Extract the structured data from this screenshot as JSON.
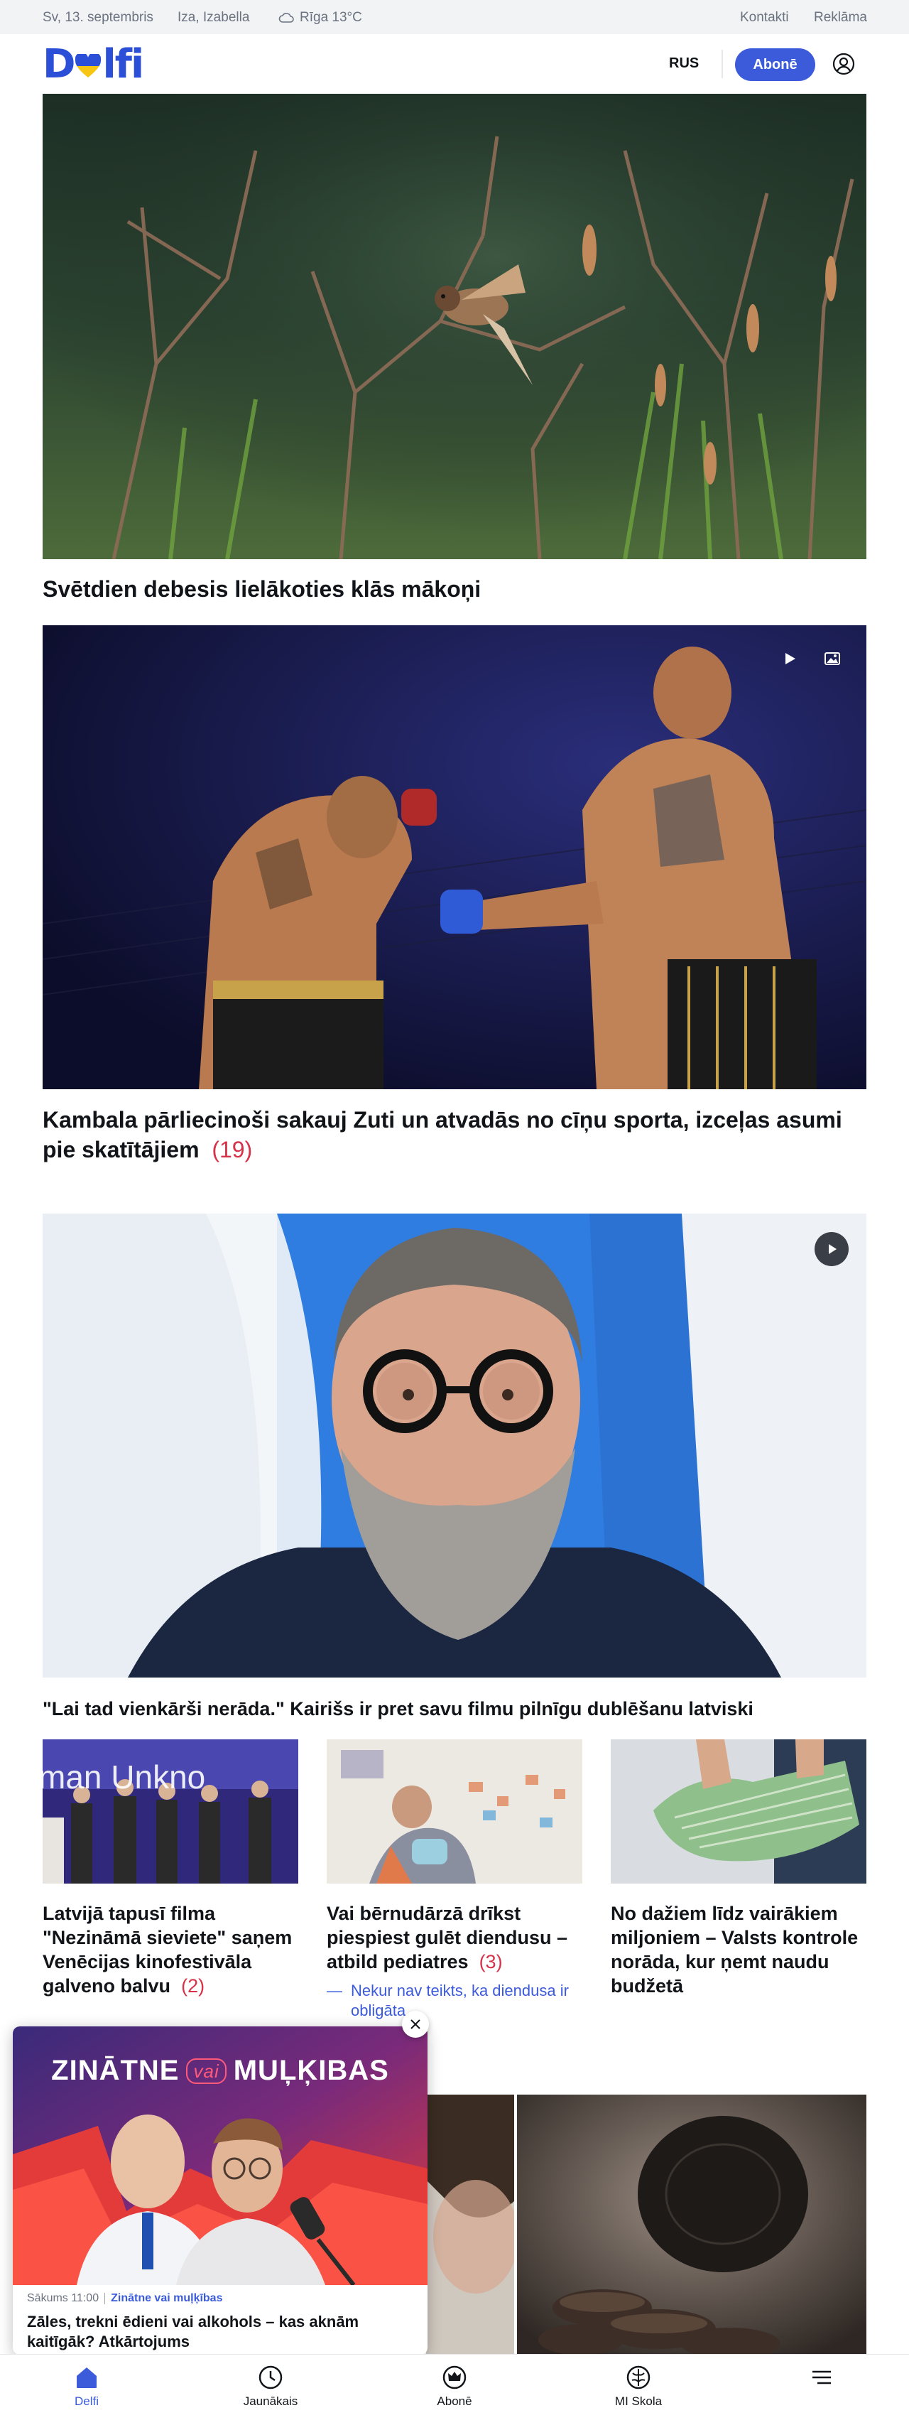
{
  "topbar": {
    "date": "Sv, 13. septembris",
    "namedays": "Iza, Izabella",
    "weather": "Rīga 13°C",
    "links": [
      "Kontakti",
      "Reklāma"
    ]
  },
  "header": {
    "logo": "Delfi",
    "language": "RUS",
    "subscribe": "Abonē"
  },
  "articles": [
    {
      "title": "Svētdien debesis lielākoties klās mākoņi"
    },
    {
      "title": "Kambala pārliecinoši sakauj Zuti un atvadās no cīņu sporta, izceļas asumi pie skatītājiem",
      "comments": "(19)"
    },
    {
      "title": "\"Lai tad vienkārši nerāda.\" Kairišs ir pret savu filmu pilnīgu dublēšanu latviski"
    }
  ],
  "small_articles": [
    {
      "title": "Latvijā tapusī filma \"Nezināmā sieviete\" saņem Venēcijas kinofestivāla galveno balvu",
      "comments": "(2)",
      "image_text": "man Unkno"
    },
    {
      "title": "Vai bērnudārzā drīkst piespiest gulēt diendusu – atbild pediatres",
      "comments": "(3)",
      "related": "Nekur nav teikts, ka diendusa ir obligāta"
    },
    {
      "title": "No dažiem līdz vairākiem miljoniem – Valsts kontrole norāda, kur ņemt naudu budžetā"
    }
  ],
  "popup": {
    "show_title_part1": "ZINĀTNE",
    "show_title_part2": "vai",
    "show_title_part3": "MUĻĶIBAS",
    "time": "Sākums 11:00",
    "category": "Zinātne vai muļķības",
    "title": "Zāles, trekni ēdieni vai alkohols – kas aknām kaitīgāk? Atkārtojums"
  },
  "bottom_nav": [
    {
      "label": "Delfi",
      "icon": "home-icon",
      "active": true
    },
    {
      "label": "Jaunākais",
      "icon": "clock-icon"
    },
    {
      "label": "Abonē",
      "icon": "crown-icon"
    },
    {
      "label": "MI Skola",
      "icon": "brain-icon"
    },
    {
      "label": "",
      "icon": "menu-icon"
    }
  ],
  "colors": {
    "accent": "#3b5bdb",
    "comments": "#d6334b",
    "topbar_bg": "#f1f3f5"
  }
}
